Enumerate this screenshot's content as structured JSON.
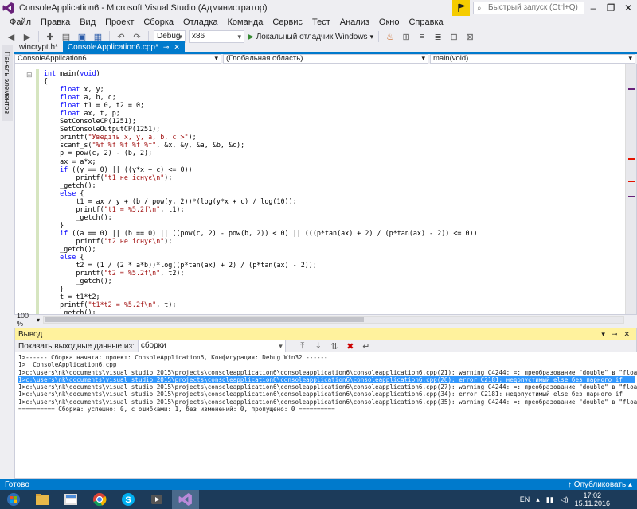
{
  "window": {
    "title": "ConsoleApplication6 - Microsoft Visual Studio (Администратор)",
    "quick_launch_placeholder": "Быстрый запуск (Ctrl+Q)",
    "accent_color": "#007ACC"
  },
  "menubar": {
    "items": [
      "Файл",
      "Правка",
      "Вид",
      "Проект",
      "Сборка",
      "Отладка",
      "Команда",
      "Сервис",
      "Тест",
      "Анализ",
      "Окно",
      "Справка"
    ]
  },
  "toolbar": {
    "configuration": "Debug",
    "platform": "x86",
    "run_label": "Локальный отладчик Windows"
  },
  "side_panel": {
    "label": "Панель элементов"
  },
  "tabs": [
    {
      "label": "wincrypt.h*",
      "active": false
    },
    {
      "label": "ConsoleApplication6.cpp*",
      "active": true
    }
  ],
  "navbar": {
    "project": "ConsoleApplication6",
    "scope": "(Глобальная область)",
    "member": "main(void)"
  },
  "editor": {
    "zoom": "100 %",
    "lines": [
      "int main(void)",
      "{",
      "    float x, y;",
      "    float a, b, c;",
      "    float t1 = 0, t2 = 0;",
      "    float ax, t, p;",
      "    SetConsoleCP(1251);",
      "    SetConsoleOutputCP(1251);",
      "    printf(\"Уведіть x, y, a, b, c >\");",
      "    scanf_s(\"%f %f %f %f %f\", &x, &y, &a, &b, &c);",
      "    p = pow(c, 2) - (b, 2);",
      "    ax = a*x;",
      "    if ((y == 0) || ((y*x + c) <= 0))",
      "        printf(\"t1 не існує\\n\");",
      "    _getch();",
      "    else {",
      "        t1 = ax / y + (b / pow(y, 2))*(log(y*x + c) / log(10));",
      "        printf(\"t1 = %5.2f\\n\", t1);",
      "        _getch();",
      "    }",
      "    if ((a == 0) || (b == 0) || ((pow(c, 2) - pow(b, 2)) < 0) || (((p*tan(ax) + 2) / (p*tan(ax) - 2)) <= 0))",
      "        printf(\"t2 не існує\\n\");",
      "    _getch();",
      "    else {",
      "        t2 = (1 / (2 * a*b))*log((p*tan(ax) + 2) / (p*tan(ax) - 2));",
      "        printf(\"t2 = %5.2f\\n\", t2);",
      "        _getch();",
      "    }",
      "    t = t1*t2;",
      "    printf(\"t1*t2 = %5.2f\\n\", t);",
      "    _getch();"
    ]
  },
  "output": {
    "title": "Вывод",
    "show_from_label": "Показать выходные данные из:",
    "source": "сборки",
    "lines": [
      "1>------ Сборка начата: проект: ConsoleApplication6, Конфигурация: Debug Win32 ------",
      "1>  ConsoleApplication6.cpp",
      "1>c:\\users\\nk\\documents\\visual studio 2015\\projects\\consoleapplication6\\consoleapplication6\\consoleapplication6.cpp(21): warning C4244: =: преобразование \"double\" в \"float\",",
      "1>c:\\users\\nk\\documents\\visual studio 2015\\projects\\consoleapplication6\\consoleapplication6\\consoleapplication6.cpp(26): error C2181: недопустимый else без парного if",
      "1>c:\\users\\nk\\documents\\visual studio 2015\\projects\\consoleapplication6\\consoleapplication6\\consoleapplication6.cpp(27): warning C4244: =: преобразование \"double\" в \"float\",",
      "1>c:\\users\\nk\\documents\\visual studio 2015\\projects\\consoleapplication6\\consoleapplication6\\consoleapplication6.cpp(34): error C2181: недопустимый else без парного if",
      "1>c:\\users\\nk\\documents\\visual studio 2015\\projects\\consoleapplication6\\consoleapplication6\\consoleapplication6.cpp(35): warning C4244: =: преобразование \"double\" в \"float\",",
      "========== Сборка: успешно: 0, с ошибками: 1, без изменений: 0, пропущено: 0 =========="
    ],
    "selected_line": 3
  },
  "statusbar": {
    "left": "Готово",
    "right": "Опубликовать"
  },
  "taskbar": {
    "apps": [
      "explorer-icon",
      "file-manager-icon",
      "chrome-icon",
      "skype-icon",
      "media-player-icon",
      "visual-studio-icon"
    ],
    "language": "EN",
    "time": "17:02",
    "date": "15.11.2016"
  }
}
